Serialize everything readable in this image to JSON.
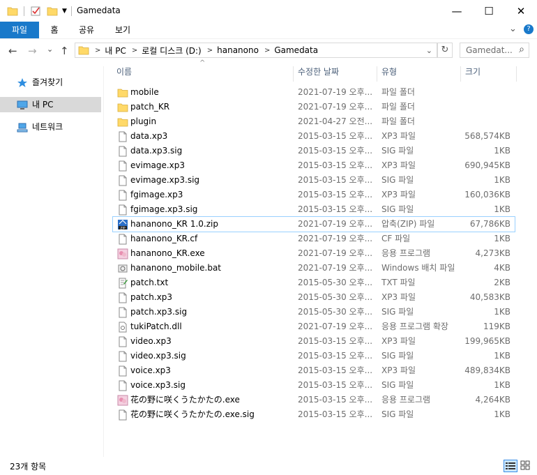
{
  "window": {
    "title": "Gamedata",
    "minimize_glyph": "—",
    "maximize_glyph": "☐",
    "close_glyph": "✕"
  },
  "ribbon": {
    "tabs": [
      {
        "label": "파일"
      },
      {
        "label": "홈"
      },
      {
        "label": "공유"
      },
      {
        "label": "보기"
      }
    ],
    "expand_glyph": "⌄",
    "help_glyph": "?"
  },
  "address": {
    "back_glyph": "←",
    "forward_glyph": "→",
    "recent_glyph": "⌄",
    "up_glyph": "↑",
    "crumbs": [
      "내 PC",
      "로컬 디스크 (D:)",
      "hananono",
      "Gamedata"
    ],
    "crumb_sep": ">",
    "dropdown_glyph": "⌄",
    "refresh_glyph": "↻",
    "search_placeholder": "Gamedat...",
    "search_icon": "⌕"
  },
  "nav": {
    "items": [
      {
        "label": "즐겨찾기",
        "icon": "star-icon"
      },
      {
        "label": "내 PC",
        "icon": "computer-icon"
      },
      {
        "label": "네트워크",
        "icon": "network-icon"
      }
    ]
  },
  "columns": {
    "name": "이름",
    "date": "수정한 날짜",
    "type": "유형",
    "size": "크기",
    "sort_glyph": "^"
  },
  "files": [
    {
      "name": "mobile",
      "date": "2021-07-19 오후...",
      "type": "파일 폴더",
      "size": "",
      "icon": "folder"
    },
    {
      "name": "patch_KR",
      "date": "2021-07-19 오후...",
      "type": "파일 폴더",
      "size": "",
      "icon": "folder"
    },
    {
      "name": "plugin",
      "date": "2021-04-27 오전...",
      "type": "파일 폴더",
      "size": "",
      "icon": "folder"
    },
    {
      "name": "data.xp3",
      "date": "2015-03-15 오후...",
      "type": "XP3 파일",
      "size": "568,574KB",
      "icon": "file"
    },
    {
      "name": "data.xp3.sig",
      "date": "2015-03-15 오후...",
      "type": "SIG 파일",
      "size": "1KB",
      "icon": "file"
    },
    {
      "name": "evimage.xp3",
      "date": "2015-03-15 오후...",
      "type": "XP3 파일",
      "size": "690,945KB",
      "icon": "file"
    },
    {
      "name": "evimage.xp3.sig",
      "date": "2015-03-15 오후...",
      "type": "SIG 파일",
      "size": "1KB",
      "icon": "file"
    },
    {
      "name": "fgimage.xp3",
      "date": "2015-03-15 오후...",
      "type": "XP3 파일",
      "size": "160,036KB",
      "icon": "file"
    },
    {
      "name": "fgimage.xp3.sig",
      "date": "2015-03-15 오후...",
      "type": "SIG 파일",
      "size": "1KB",
      "icon": "file"
    },
    {
      "name": "hananono_KR 1.0.zip",
      "date": "2021-07-19 오후...",
      "type": "압축(ZIP) 파일",
      "size": "67,786KB",
      "icon": "zip",
      "selected": true
    },
    {
      "name": "hananono_KR.cf",
      "date": "2021-07-19 오후...",
      "type": "CF 파일",
      "size": "1KB",
      "icon": "file"
    },
    {
      "name": "hananono_KR.exe",
      "date": "2021-07-19 오후...",
      "type": "응용 프로그램",
      "size": "4,273KB",
      "icon": "exe"
    },
    {
      "name": "hananono_mobile.bat",
      "date": "2021-07-19 오후...",
      "type": "Windows 배치 파일",
      "size": "4KB",
      "icon": "bat"
    },
    {
      "name": "patch.txt",
      "date": "2015-05-30 오후...",
      "type": "TXT 파일",
      "size": "2KB",
      "icon": "txt"
    },
    {
      "name": "patch.xp3",
      "date": "2015-05-30 오후...",
      "type": "XP3 파일",
      "size": "40,583KB",
      "icon": "file"
    },
    {
      "name": "patch.xp3.sig",
      "date": "2015-05-30 오후...",
      "type": "SIG 파일",
      "size": "1KB",
      "icon": "file"
    },
    {
      "name": "tukiPatch.dll",
      "date": "2021-07-19 오후...",
      "type": "응용 프로그램 확장",
      "size": "119KB",
      "icon": "dll"
    },
    {
      "name": "video.xp3",
      "date": "2015-03-15 오후...",
      "type": "XP3 파일",
      "size": "199,965KB",
      "icon": "file"
    },
    {
      "name": "video.xp3.sig",
      "date": "2015-03-15 오후...",
      "type": "SIG 파일",
      "size": "1KB",
      "icon": "file"
    },
    {
      "name": "voice.xp3",
      "date": "2015-03-15 오후...",
      "type": "XP3 파일",
      "size": "489,834KB",
      "icon": "file"
    },
    {
      "name": "voice.xp3.sig",
      "date": "2015-03-15 오후...",
      "type": "SIG 파일",
      "size": "1KB",
      "icon": "file"
    },
    {
      "name": "花の野に咲くうたかたの.exe",
      "date": "2015-03-15 오후...",
      "type": "응용 프로그램",
      "size": "4,264KB",
      "icon": "exe"
    },
    {
      "name": "花の野に咲くうたかたの.exe.sig",
      "date": "2015-03-15 오후...",
      "type": "SIG 파일",
      "size": "1KB",
      "icon": "file"
    }
  ],
  "status": {
    "count": "23개 항목"
  },
  "colors": {
    "accent": "#1979ca",
    "nav_selected": "#d9d9d9",
    "folder": "#ffd968",
    "header_text": "#4c607a"
  }
}
